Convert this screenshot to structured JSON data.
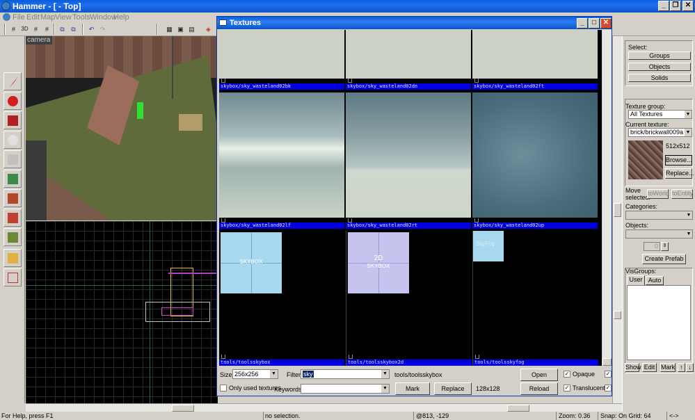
{
  "app": {
    "title": "Hammer - [ - Top]",
    "menu": [
      "File",
      "Edit",
      "Map",
      "View",
      "Tools",
      "Window",
      "Help"
    ]
  },
  "viewport_3d": {
    "label": "camera"
  },
  "status": {
    "help": "For Help, press F1",
    "selection": "no selection.",
    "coords": "@813, -129",
    "zoom": "Zoom: 0.36",
    "snap": "Snap: On Grid: 64",
    "extra": "<->"
  },
  "right_panel": {
    "select_label": "Select:",
    "groups": "Groups",
    "objects": "Objects",
    "solids": "Solids",
    "texture_group_label": "Texture group:",
    "texture_group_value": "All Textures",
    "current_texture_label": "Current texture:",
    "current_texture_value": "brick/brickwall009a",
    "texture_size": "512x512",
    "browse": "Browse...",
    "replace": "Replace...",
    "move_selected_label": "Move\nselected:",
    "to_world": "toWorld",
    "to_entity": "toEntity",
    "categories_label": "Categories:",
    "objects_label": "Objects:",
    "spin_value": "0",
    "create_prefab": "Create Prefab",
    "visgroups_label": "VisGroups:",
    "tab_user": "User",
    "tab_auto": "Auto",
    "show": "Show",
    "edit": "Edit",
    "mark": "Mark"
  },
  "textures_window": {
    "title": "Textures",
    "cells": [
      {
        "caption": "skybox/sky_wasteland02bk"
      },
      {
        "caption": "skybox/sky_wasteland02dn"
      },
      {
        "caption": "skybox/sky_wasteland02ft"
      },
      {
        "caption": "skybox/sky_wasteland02lf"
      },
      {
        "caption": "skybox/sky_wasteland02rt"
      },
      {
        "caption": "skybox/sky_wasteland02up"
      },
      {
        "caption": "tools/toolsskybox",
        "tile_text": "SKYBOX"
      },
      {
        "caption": "tools/toolsskybox2d",
        "tile_text_a": "2D",
        "tile_text_b": "SKYBOX"
      },
      {
        "caption": "tools/toolsskyfog",
        "tile_text": "SkyFog"
      }
    ],
    "size_label": "Size:",
    "size_value": "256x256",
    "filter_label": "Filter:",
    "filter_value": "sky",
    "selected_name": "tools/toolsskybox",
    "selected_size": "128x128",
    "only_used_label": "Only used textures",
    "keywords_label": "Keywords:",
    "keywords_value": "",
    "mark": "Mark",
    "replace": "Replace",
    "open_source": "Open Source",
    "reload": "Reload",
    "opaque_label": "Opaque",
    "translucent_label": "Translucent"
  }
}
